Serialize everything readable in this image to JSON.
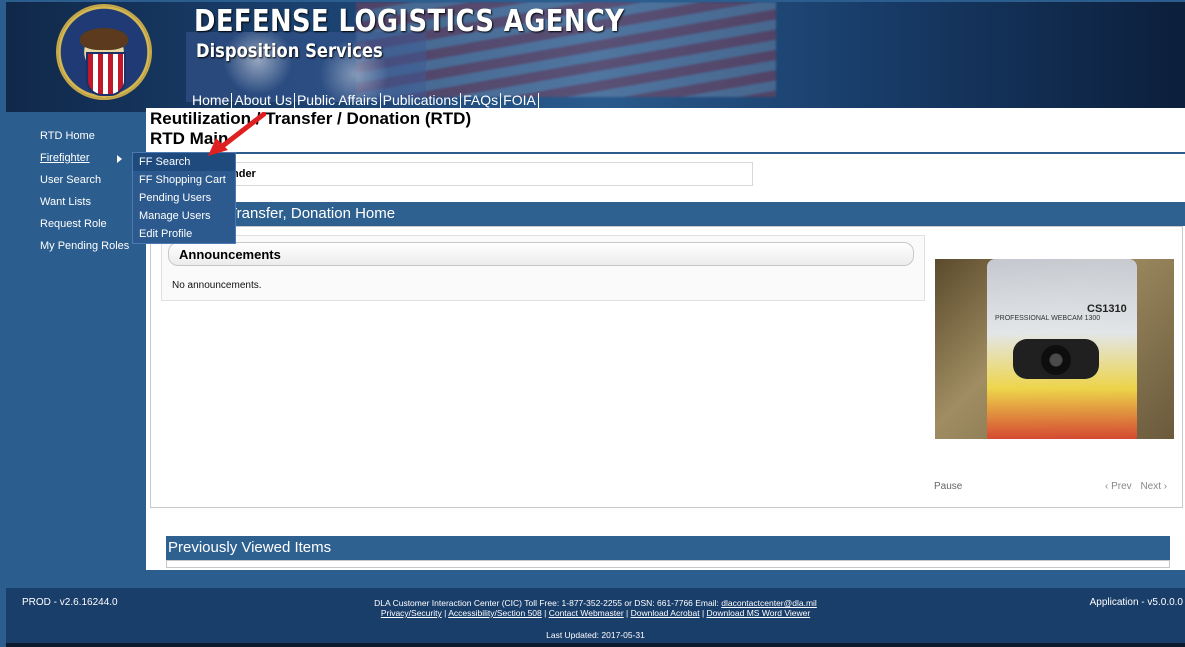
{
  "header": {
    "title": "DEFENSE LOGISTICS AGENCY",
    "subtitle": "Disposition Services",
    "nav": [
      "Home",
      "About Us",
      "Public Affairs",
      "Publications",
      "FAQs",
      "FOIA"
    ]
  },
  "page": {
    "title": "Reutilization / Transfer / Donation (RTD)",
    "subtitle": "RTD Main",
    "tab_label": "nder"
  },
  "leftnav": {
    "items": [
      "RTD Home",
      "Firefighter",
      "User Search",
      "Want Lists",
      "Request Role",
      "My Pending Roles"
    ]
  },
  "flyout": {
    "items": [
      "FF Search",
      "FF Shopping Cart",
      "Pending Users",
      "Manage Users",
      "Edit Profile"
    ]
  },
  "main": {
    "section_title": ", Transfer, Donation Home",
    "announcements_title": "Announcements",
    "announcements_body": "No announcements.",
    "photo_model": "CS1310",
    "photo_label": "PROFESSIONAL WEBCAM 1300",
    "pause_label": "Pause",
    "prev_label": "‹ Prev",
    "next_label": "Next ›",
    "previously_viewed": "Previously Viewed Items"
  },
  "footer": {
    "version": "PROD - v2.6.16244.0",
    "app_version": "Application - v5.0.0.0",
    "contact_line": "DLA Customer Interaction Center (CIC) Toll Free: 1-877-352-2255 or DSN: 661-7766 Email: ",
    "email": "dlacontactcenter@dla.mil",
    "links": [
      "Privacy/Security",
      "Accessibility/Section 508",
      "Contact Webmaster",
      "Download Acrobat",
      "Download MS Word Viewer"
    ],
    "last_updated": "Last Updated: 2017-05-31"
  },
  "colors": {
    "nav_blue": "#2b5d8e",
    "section_blue": "#2f6190",
    "arrow_red": "#e02020"
  }
}
